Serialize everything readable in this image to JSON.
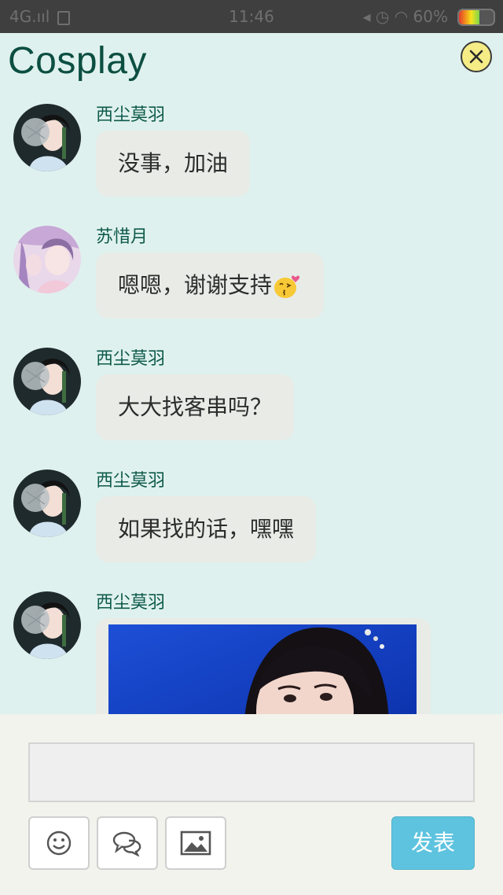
{
  "status_bar": {
    "network": "4G.ııl",
    "time": "11:46",
    "battery_text": "60%",
    "battery_level": 0.6
  },
  "header": {
    "title": "Cosplay"
  },
  "messages": [
    {
      "sender": "西尘莫羽",
      "text": "没事，加油",
      "avatar": "girl-with-fan-avatar"
    },
    {
      "sender": "苏惜月",
      "text": "嗯嗯，谢谢支持",
      "avatar": "pink-hair-girl-avatar",
      "emoji": "kiss-emoji"
    },
    {
      "sender": "西尘莫羽",
      "text": "大大找客串吗？",
      "avatar": "girl-with-fan-avatar"
    },
    {
      "sender": "西尘莫羽",
      "text": "如果找的话，嘿嘿",
      "avatar": "girl-with-fan-avatar"
    },
    {
      "sender": "西尘莫羽",
      "text": "",
      "avatar": "girl-with-fan-avatar",
      "image": "photo-of-woman"
    }
  ],
  "composer": {
    "input_value": "",
    "send_label": "发表",
    "tools": [
      "smiley-icon",
      "chat-bubbles-icon",
      "image-icon"
    ]
  },
  "colors": {
    "background": "#dff1ee",
    "title": "#0c4f42",
    "sender": "#0e5a4b",
    "bubble": "#e8ebe6",
    "send_button": "#5ec3df",
    "composer": "#f2f3ec"
  }
}
